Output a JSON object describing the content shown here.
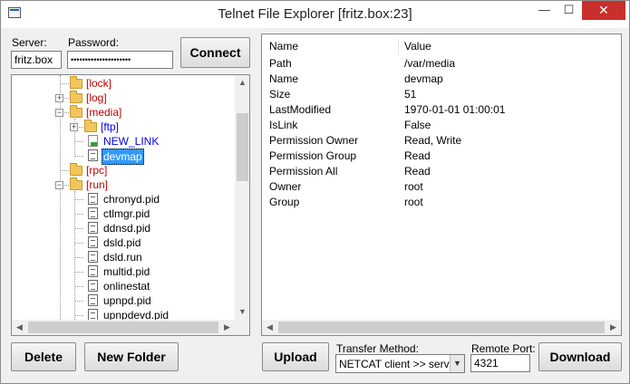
{
  "window": {
    "title": "Telnet File Explorer [fritz.box:23]",
    "minimize_glyph": "—",
    "maximize_glyph": "☐",
    "close_glyph": "✕"
  },
  "connection": {
    "server_label": "Server:",
    "server_value": "fritz.box",
    "password_label": "Password:",
    "password_value": "•••••••••••••••••••••",
    "connect_label": "Connect"
  },
  "tree": {
    "items": [
      {
        "label": "[lock]",
        "kind": "folder",
        "color": "#c00000"
      },
      {
        "label": "[log]",
        "kind": "folder",
        "color": "#c00000"
      },
      {
        "label": "[media]",
        "kind": "folder",
        "color": "#c00000"
      },
      {
        "label": "[ftp]",
        "kind": "folder",
        "color": "#0000ee"
      },
      {
        "label": "NEW_LINK",
        "kind": "link",
        "color": "#0000ee"
      },
      {
        "label": "devmap",
        "kind": "file",
        "selected": true
      },
      {
        "label": "[rpc]",
        "kind": "folder",
        "color": "#c00000"
      },
      {
        "label": "[run]",
        "kind": "folder",
        "color": "#c00000"
      },
      {
        "label": "chronyd.pid",
        "kind": "file"
      },
      {
        "label": "ctlmgr.pid",
        "kind": "file"
      },
      {
        "label": "ddnsd.pid",
        "kind": "file"
      },
      {
        "label": "dsld.pid",
        "kind": "file"
      },
      {
        "label": "dsld.run",
        "kind": "file"
      },
      {
        "label": "multid.pid",
        "kind": "file"
      },
      {
        "label": "onlinestat",
        "kind": "file"
      },
      {
        "label": "upnpd.pid",
        "kind": "file"
      },
      {
        "label": "upnpdevd.pid",
        "kind": "file"
      }
    ]
  },
  "properties": {
    "col_name": "Name",
    "col_value": "Value",
    "rows": [
      {
        "name": "Path",
        "value": "/var/media"
      },
      {
        "name": "Name",
        "value": "devmap"
      },
      {
        "name": "Size",
        "value": "51"
      },
      {
        "name": "LastModified",
        "value": "1970-01-01 01:00:01"
      },
      {
        "name": "IsLink",
        "value": "False"
      },
      {
        "name": "Permission Owner",
        "value": "Read, Write"
      },
      {
        "name": "Permission Group",
        "value": "Read"
      },
      {
        "name": "Permission All",
        "value": "Read"
      },
      {
        "name": "Owner",
        "value": "root"
      },
      {
        "name": "Group",
        "value": "root"
      }
    ]
  },
  "actions": {
    "delete_label": "Delete",
    "new_folder_label": "New Folder",
    "upload_label": "Upload",
    "download_label": "Download",
    "transfer_method_label": "Transfer Method:",
    "transfer_method_value": "NETCAT client >> server",
    "remote_port_label": "Remote Port:",
    "remote_port_value": "4321"
  }
}
